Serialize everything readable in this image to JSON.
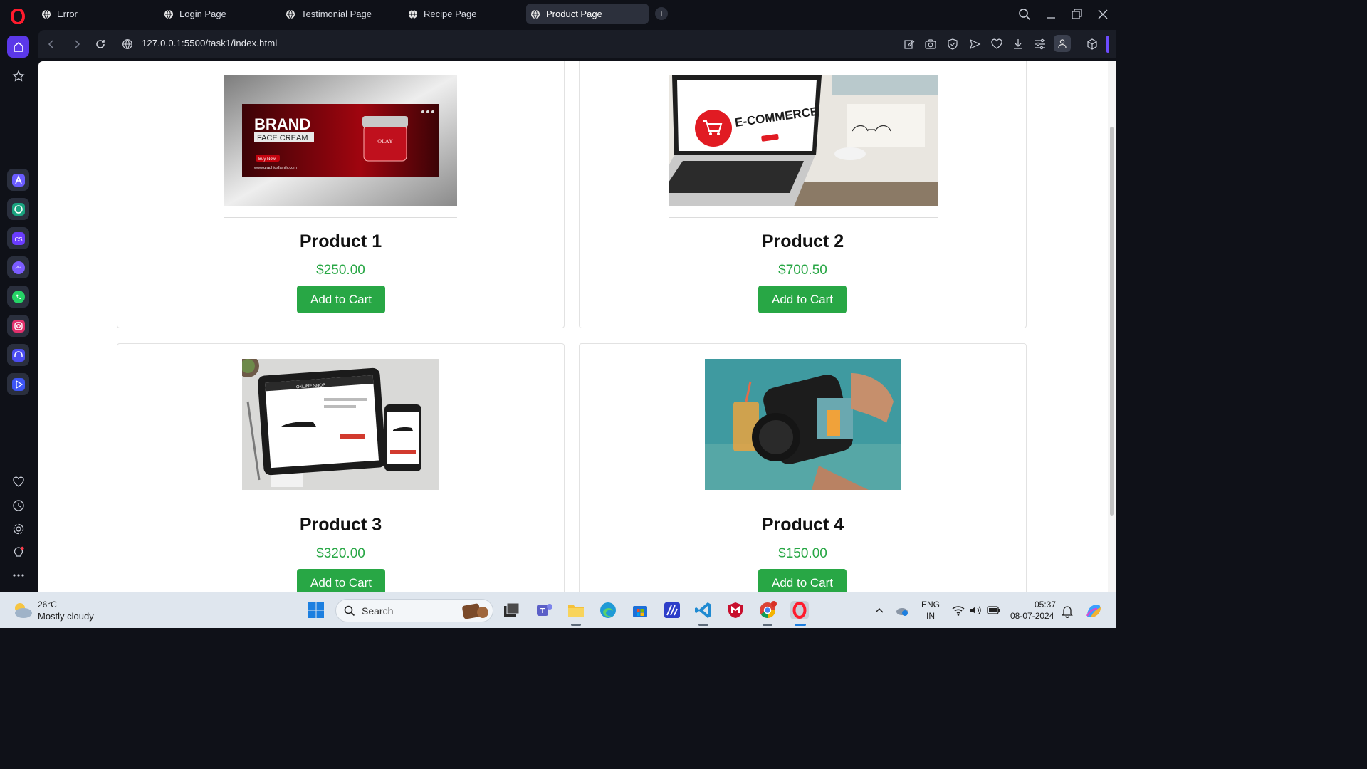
{
  "browser": {
    "tabs": [
      {
        "label": "Error",
        "active": false
      },
      {
        "label": "Login Page",
        "active": false
      },
      {
        "label": "Testimonial Page",
        "active": false
      },
      {
        "label": "Recipe Page",
        "active": false
      },
      {
        "label": "Product Page",
        "active": true
      }
    ],
    "url": "127.0.0.1:5500/task1/index.html"
  },
  "products": [
    {
      "name": "Product 1",
      "price": "$250.00",
      "button": "Add to Cart",
      "image": "brand-face-cream-banner"
    },
    {
      "name": "Product 2",
      "price": "$700.50",
      "button": "Add to Cart",
      "image": "e-commerce-laptop"
    },
    {
      "name": "Product 3",
      "price": "$320.00",
      "button": "Add to Cart",
      "image": "online-shop-tablet"
    },
    {
      "name": "Product 4",
      "price": "$150.00",
      "button": "Add to Cart",
      "image": "camera-in-hands"
    }
  ],
  "images": {
    "banner_brand": "BRAND",
    "banner_sub": "FACE CREAM",
    "banner_btn": "Buy Now",
    "banner_url": "www.graphicsfamily.com",
    "banner_jar": "OLAY",
    "laptop_text": "E-COMMERCE",
    "tablet_header": "ONLINE SHOP"
  },
  "taskbar": {
    "weather_temp": "26°C",
    "weather_desc": "Mostly cloudy",
    "search_placeholder": "Search",
    "lang_top": "ENG",
    "lang_bottom": "IN",
    "time": "05:37",
    "date": "08-07-2024"
  },
  "colors": {
    "accent_green": "#28a745",
    "opera_red": "#ff1b2d",
    "sidebar_home": "#5b38e8"
  }
}
